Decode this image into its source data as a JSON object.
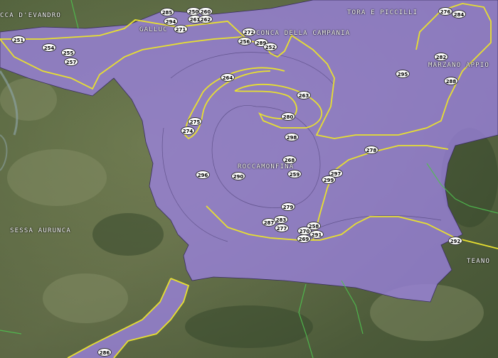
{
  "places": [
    {
      "id": "ca-devandro",
      "label": "CCA D'EVANDRO"
    },
    {
      "id": "galluccio",
      "label": "GALLUC"
    },
    {
      "id": "conca",
      "label": "CONCA DELLA CAMPANIA"
    },
    {
      "id": "tora",
      "label": "TORA E PICCILLI"
    },
    {
      "id": "marzano",
      "label": "MARZANO APPIO"
    },
    {
      "id": "roccamonfina",
      "label": "ROCCAMONFINA"
    },
    {
      "id": "sessa",
      "label": "SESSA AURUNCA"
    },
    {
      "id": "teano",
      "label": "TEANO"
    }
  ],
  "markers": [
    "285",
    "250",
    "260",
    "294",
    "261",
    "262",
    "271",
    "272",
    "256",
    "289",
    "252",
    "251",
    "254",
    "255",
    "257",
    "276",
    "284",
    "282",
    "288",
    "295",
    "264",
    "263",
    "280",
    "275",
    "274",
    "278",
    "298",
    "268",
    "296",
    "290",
    "259",
    "297",
    "299",
    "279",
    "287",
    "283",
    "277",
    "258",
    "270",
    "291",
    "269",
    "292",
    "286"
  ],
  "colors": {
    "area": "#9b82e0",
    "boundary": "#e8e030",
    "limits": "#4fbf4f"
  }
}
